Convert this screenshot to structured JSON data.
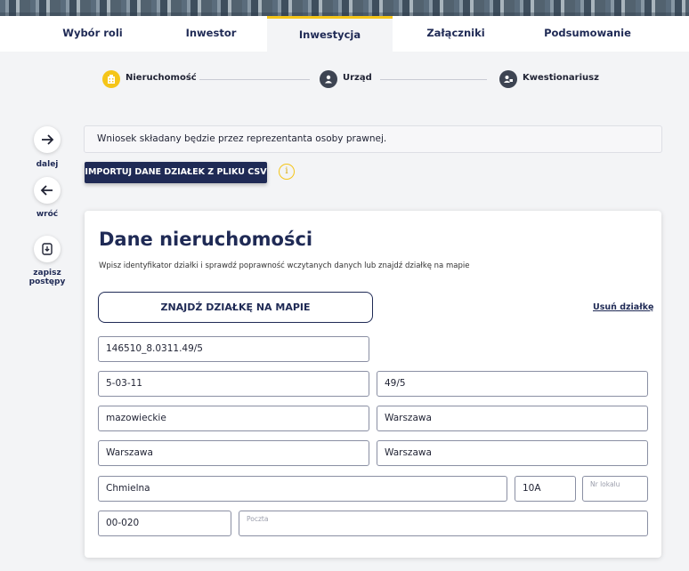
{
  "tabs": [
    {
      "label": "Wybór roli"
    },
    {
      "label": "Inwestor"
    },
    {
      "label": "Inwestycja"
    },
    {
      "label": "Załączniki"
    },
    {
      "label": "Podsumowanie"
    }
  ],
  "stepper": [
    {
      "label": "Nieruchomość"
    },
    {
      "label": "Urząd"
    },
    {
      "label": "Kwestionariusz"
    }
  ],
  "side": {
    "next_label": "dalej",
    "back_label": "wróć",
    "save_label": "zapisz postępy"
  },
  "notice": "Wniosek składany będzie przez reprezentanta osoby prawnej.",
  "import_csv_label": "IMPORTUJ DANE DZIAŁEK Z PLIKU CSV",
  "info_glyph": "i",
  "card": {
    "title": "Dane nieruchomości",
    "subtitle": "Wpisz identyfikator działki i sprawdź poprawność wczytanych danych lub znajdź działkę na mapie",
    "map_button_label": "ZNAJDŹ DZIAŁKĘ NA MAPIE",
    "remove_label": "Usuń działkę",
    "fields": {
      "parcel_id": "146510_8.0311.49/5",
      "precinct": "5-03-11",
      "parcel_number": "49/5",
      "voivodeship": "mazowieckie",
      "county": "Warszawa",
      "commune": "Warszawa",
      "city": "Warszawa",
      "street": "Chmielna",
      "building_number": "10A",
      "apartment_placeholder": "Nr lokalu",
      "postal_code": "00-020",
      "post_office_placeholder": "Poczta"
    }
  },
  "colors": {
    "navy": "#1f2a55",
    "accent_yellow": "#f5c518",
    "step_inactive": "#3d4452"
  }
}
